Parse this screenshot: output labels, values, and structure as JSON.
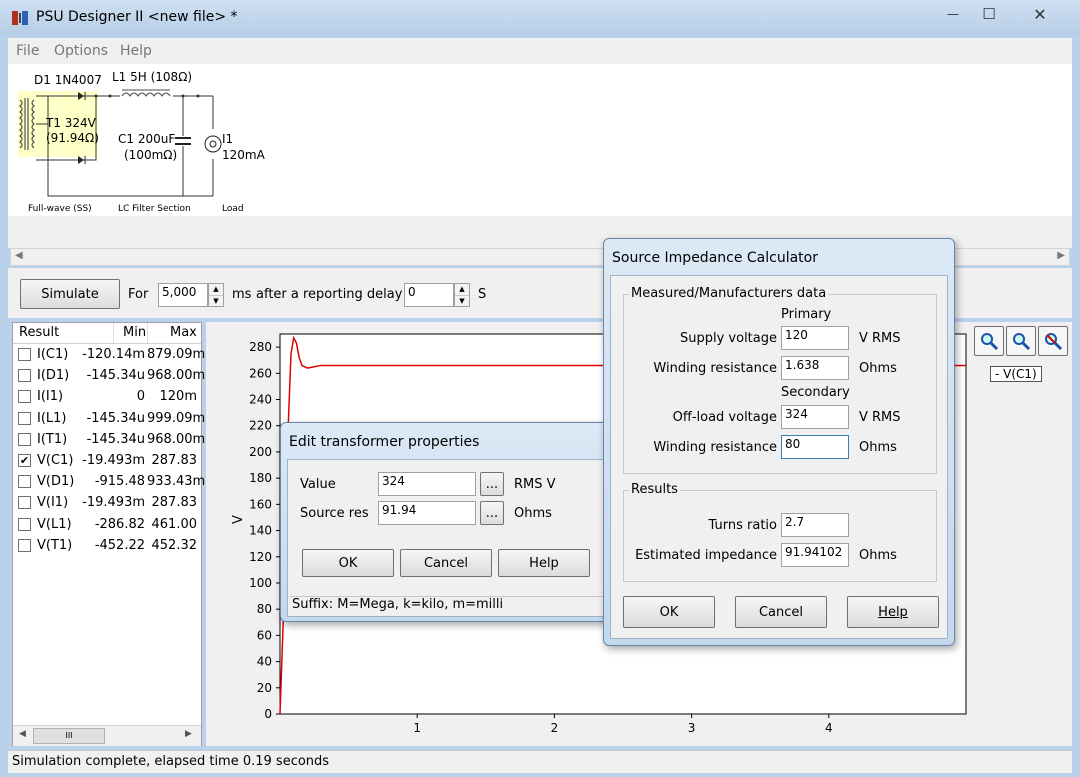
{
  "window": {
    "title": "PSU Designer II  <new file> *",
    "minimize_glyph": "—",
    "maximize_glyph": "☐",
    "close_glyph": "✕"
  },
  "menu": [
    "File",
    "Options",
    "Help"
  ],
  "schematic": {
    "d1_label": "D1 1N4007",
    "l1_label": "L1 5H (108Ω)",
    "t1_label_line1": "T1 324V",
    "t1_label_line2": "(91.94Ω)",
    "c1_label_line1": "C1 200uF",
    "c1_label_line2": "(100mΩ)",
    "i1_label_line1": "I1",
    "i1_label_line2": "120mA",
    "section_rectifier": "Full-wave (SS)",
    "section_filter": "LC Filter Section",
    "section_load": "Load"
  },
  "toolbar": {
    "simulate_label": "Simulate",
    "for_label": "For",
    "duration_value": "5,000",
    "ms_label": "ms",
    "delay_label": "after a reporting delay of",
    "delay_value": "0",
    "s_label": "S"
  },
  "results": {
    "headers": [
      "Result",
      "Min",
      "Max"
    ],
    "rows": [
      {
        "name": "I(C1)",
        "min": "-120.14m",
        "max": "879.09m",
        "checked": false
      },
      {
        "name": "I(D1)",
        "min": "-145.34u",
        "max": "968.00m",
        "checked": false
      },
      {
        "name": "I(I1)",
        "min": "0",
        "max": "120m",
        "checked": false
      },
      {
        "name": "I(L1)",
        "min": "-145.34u",
        "max": "999.09m",
        "checked": false
      },
      {
        "name": "I(T1)",
        "min": "-145.34u",
        "max": "968.00m",
        "checked": false
      },
      {
        "name": "V(C1)",
        "min": "-19.493m",
        "max": "287.83",
        "checked": true
      },
      {
        "name": "V(D1)",
        "min": "-915.48",
        "max": "933.43m",
        "checked": false
      },
      {
        "name": "V(I1)",
        "min": "-19.493m",
        "max": "287.83",
        "checked": false
      },
      {
        "name": "V(L1)",
        "min": "-286.82",
        "max": "461.00",
        "checked": false
      },
      {
        "name": "V(T1)",
        "min": "-452.22",
        "max": "452.32",
        "checked": false
      }
    ],
    "check_glyph": "✔",
    "scroll_thumb": "III"
  },
  "chart_data": {
    "type": "line",
    "ylabel": "V",
    "xlabel": "",
    "ylim": [
      0,
      290
    ],
    "xlim": [
      0,
      5.0
    ],
    "y_ticks": [
      0,
      20,
      40,
      60,
      80,
      100,
      120,
      140,
      160,
      180,
      200,
      220,
      240,
      260,
      280
    ],
    "x_ticks": [
      1,
      2,
      3,
      4
    ],
    "grid": false,
    "series": [
      {
        "name": "V(C1)",
        "color": "#e00000",
        "x": [
          0,
          0.04,
          0.06,
          0.08,
          0.1,
          0.12,
          0.14,
          0.16,
          0.2,
          0.25,
          0.3,
          0.4,
          5.0
        ],
        "y": [
          0,
          120,
          220,
          275,
          287,
          283,
          272,
          266,
          264,
          265,
          266,
          266,
          266
        ]
      }
    ],
    "legend_text": "- V(C1)",
    "legend_position": "top-right"
  },
  "zoom_icons": [
    "zoom-in-icon",
    "zoom-out-icon",
    "zoom-reset-icon"
  ],
  "status": "Simulation complete, elapsed time 0.19 seconds",
  "transformer_dialog": {
    "title": "Edit transformer properties",
    "value_label": "Value",
    "value": "324",
    "value_unit": "RMS V",
    "source_res_label": "Source res",
    "source_res": "91.94",
    "source_res_unit": "Ohms",
    "ellipsis": "...",
    "ok": "OK",
    "cancel": "Cancel",
    "help": "Help",
    "suffix_hint": "Suffix: M=Mega, k=kilo, m=milli"
  },
  "impedance_dialog": {
    "title": "Source Impedance Calculator",
    "group_measured": "Measured/Manufacturers data",
    "primary_label": "Primary",
    "supply_voltage_label": "Supply voltage",
    "supply_voltage": "120",
    "supply_voltage_unit": "V RMS",
    "winding_res_label": "Winding resistance",
    "primary_winding_res": "1.638",
    "ohms_unit": "Ohms",
    "secondary_label": "Secondary",
    "offload_voltage_label": "Off-load voltage",
    "offload_voltage": "324",
    "offload_voltage_unit": "V RMS",
    "secondary_winding_res": "80",
    "group_results": "Results",
    "turns_ratio_label": "Turns ratio",
    "turns_ratio": "2.7",
    "est_impedance_label": "Estimated impedance",
    "est_impedance": "91.94102",
    "ok": "OK",
    "cancel": "Cancel",
    "help": "Help"
  }
}
